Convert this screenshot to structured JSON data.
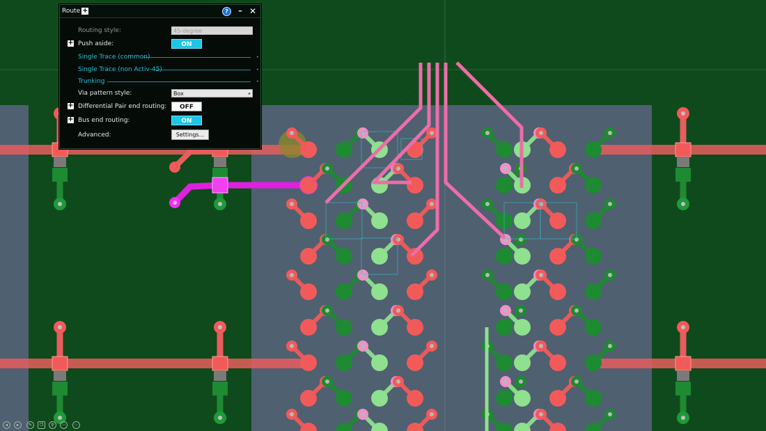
{
  "panel": {
    "title": "Route",
    "help_glyph": "?",
    "minimize_glyph": "–",
    "close_glyph": "✕",
    "expand_glyph": "+",
    "rows": {
      "routing_style": {
        "label": "Routing style:",
        "value": "45-degree"
      },
      "push_aside": {
        "label": "Push aside:",
        "state": "ON"
      },
      "single_trace_common": {
        "label": "Single Trace (common)"
      },
      "single_trace_non_activ": {
        "label": "Single Trace (non Activ-45)"
      },
      "trunking": {
        "label": "Trunking"
      },
      "via_pattern": {
        "label": "Via pattern style:",
        "value": "Box"
      },
      "diff_pair": {
        "label": "Differential Pair end routing:",
        "state": "OFF"
      },
      "bus_end": {
        "label": "Bus end routing:",
        "state": "ON"
      },
      "advanced": {
        "label": "Advanced:",
        "button": "Settings..."
      }
    }
  },
  "colors": {
    "board_bg": "#0f4a1c",
    "plane": "#4f6070",
    "red_pad": "#f25a5a",
    "red_trace": "#e85d5d",
    "light_green_pad": "#8fe08f",
    "dark_green_pad": "#1e8a32",
    "pink_trace": "#ec6ea8",
    "pink_pad": "#f090c8",
    "magenta": "#e020e0",
    "accent_cyan": "#1ec5e6"
  },
  "nav_icons": [
    "prev-icon",
    "next-icon",
    "edit-icon",
    "copy-icon",
    "zoom-icon",
    "more-icon",
    "more-icon"
  ]
}
